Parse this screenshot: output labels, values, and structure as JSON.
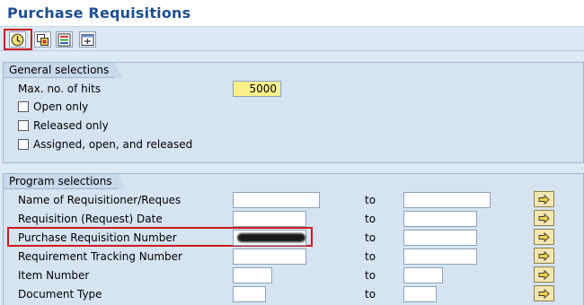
{
  "page": {
    "title": "Purchase Requisitions"
  },
  "toolbar": {
    "buttons": [
      {
        "icon": "execute-icon",
        "highlighted": true
      },
      {
        "icon": "variant-icon"
      },
      {
        "icon": "selection-options-icon"
      },
      {
        "icon": "dynamic-selection-icon"
      }
    ]
  },
  "general_selections": {
    "title": "General selections",
    "max_hits_label": "Max. no. of hits",
    "max_hits_value": "5000",
    "options": [
      {
        "label": "Open only",
        "checked": false
      },
      {
        "label": "Released only",
        "checked": false
      },
      {
        "label": "Assigned, open, and released",
        "checked": false
      }
    ]
  },
  "program_selections": {
    "title": "Program selections",
    "to_label": "to",
    "rows": [
      {
        "label": "Name of Requisitioner/Reques",
        "from": "",
        "to": ""
      },
      {
        "label": "Requisition (Request) Date",
        "from": "",
        "to": ""
      },
      {
        "label": "Purchase Requisition Number",
        "from": "",
        "to": "",
        "redacted": true,
        "highlighted": true
      },
      {
        "label": "Requirement Tracking Number",
        "from": "",
        "to": ""
      },
      {
        "label": "Item Number",
        "from": "",
        "to": ""
      },
      {
        "label": "Document Type",
        "from": "",
        "to": ""
      }
    ],
    "multiple_selection_icon": "arrow-right-icon"
  },
  "colors": {
    "title": "#1d4f91",
    "highlight": "#d0181e",
    "required_field": "#fbf08a"
  }
}
